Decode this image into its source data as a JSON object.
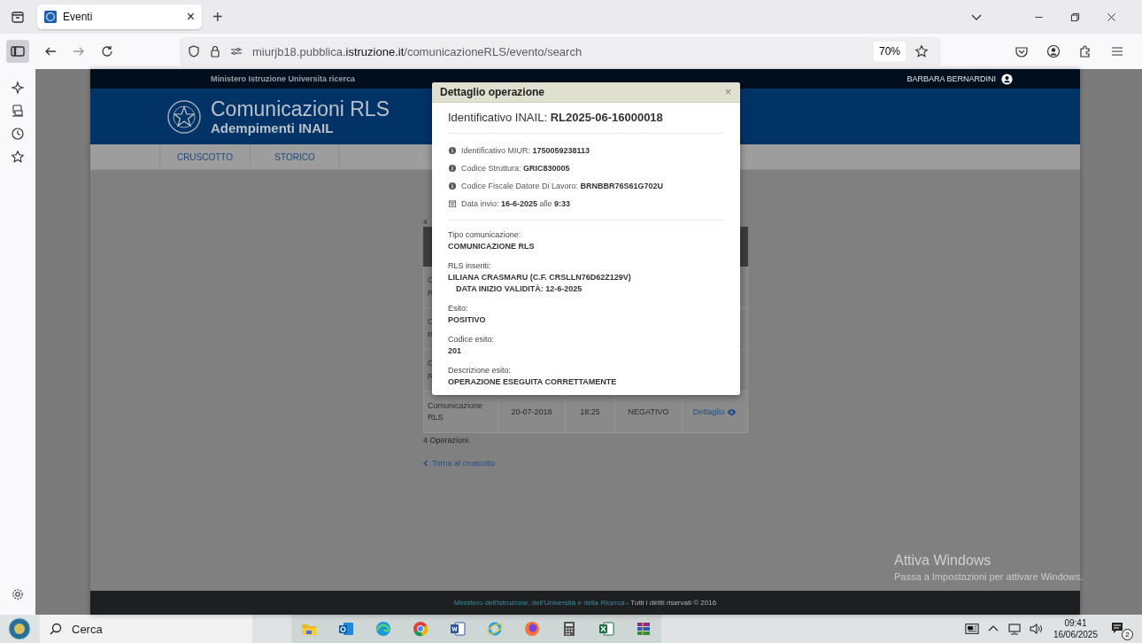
{
  "browser": {
    "tab": {
      "title": "Eventi",
      "close": "×",
      "selected": true
    },
    "new_tab": "+",
    "url": {
      "prefix": "miurjb18.pubblica.",
      "domain": "istruzione.it",
      "path": "/comunicazioneRLS/evento/search"
    },
    "zoom": "70%"
  },
  "page": {
    "ministry": "Ministero Istruzione Universita ricerca",
    "user": "BARBARA BERNARDINI",
    "title": "Comunicazioni RLS",
    "subtitle": "Adempimenti INAIL",
    "nav": [
      {
        "label": "CRUSCOTTO"
      },
      {
        "label": "STORICO"
      }
    ],
    "count_fragment": "4",
    "table": {
      "row_fragments": [
        [
          "C",
          "R"
        ],
        [
          "C",
          "R"
        ],
        [
          "C",
          "R"
        ]
      ],
      "last_row": {
        "type": "Comunicazione RLS",
        "date": "20-07-2018",
        "time": "18:25",
        "outcome": "NEGATIVO",
        "link": "Dettaglio"
      }
    },
    "summary": "4 Operazioni.",
    "back_link": "Torna al cruscotto",
    "footer": {
      "link": "Ministero dell'Istruzione, dell'Università e della Ricerca",
      "rest": " - Tutti i diritti riservati © 2016"
    }
  },
  "modal": {
    "title": "Dettaglio operazione",
    "close": "×",
    "heading": "Identificativo INAIL: **RL2025-06-16000018**",
    "meta": [
      {
        "kind": "info",
        "text": "Identificativo MIUR: **1750059238113**"
      },
      {
        "kind": "info",
        "text": "Codice Struttura: **GRIC830005**"
      },
      {
        "kind": "info",
        "text": "Codice Fiscale Datore Di Lavoro: **BRNBBR76S61G702U**"
      },
      {
        "kind": "date",
        "text": "Data invio: **16-6-2025** alle **9:33**"
      }
    ],
    "sections": [
      {
        "label": "Tipo comunicazione:",
        "lines": [
          {
            "text": "COMUNICAZIONE RLS",
            "indented": false
          }
        ]
      },
      {
        "label": "RLS inseriti:",
        "lines": [
          {
            "text": "LILIANA CRASMARU (C.F. CRSLLN76D62Z129V)",
            "indented": false
          },
          {
            "text": "DATA INIZIO VALIDITÀ: 12-6-2025",
            "indented": true
          }
        ]
      },
      {
        "label": "Esito:",
        "lines": [
          {
            "text": "POSITIVO",
            "indented": false
          }
        ]
      },
      {
        "label": "Codice esito:",
        "lines": [
          {
            "text": "201",
            "indented": false
          }
        ]
      },
      {
        "label": "Descrizione esito:",
        "lines": [
          {
            "text": "OPERAZIONE ESEGUITA CORRETTAMENTE",
            "indented": false
          }
        ]
      }
    ]
  },
  "windows_notice": {
    "title": "Attiva Windows",
    "subtitle": "Passa a Impostazioni per attivare Windows."
  },
  "taskbar": {
    "search": "Cerca",
    "time": "09:41",
    "date": "16/06/2025",
    "notifications": "2"
  }
}
